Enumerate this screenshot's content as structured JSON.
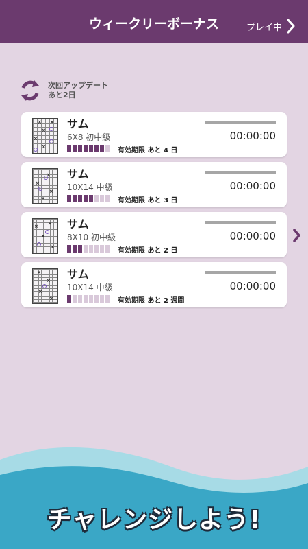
{
  "header": {
    "title": "ウィークリーボーナス",
    "playing_label": "プレイ中"
  },
  "update": {
    "line1": "次回アップデート",
    "line2": "あと2日"
  },
  "cards": [
    {
      "title": "サム",
      "size": "6X8 初中級",
      "filled": 7,
      "total": 8,
      "expiry": "有効期限 あと 4 日",
      "time": "00:00:00"
    },
    {
      "title": "サム",
      "size": "10X14 中級",
      "filled": 5,
      "total": 8,
      "expiry": "有効期限 あと 3 日",
      "time": "00:00:00"
    },
    {
      "title": "サム",
      "size": "8X10 初中級",
      "filled": 3,
      "total": 8,
      "expiry": "有効期限 あと 2 日",
      "time": "00:00:00"
    },
    {
      "title": "サム",
      "size": "10X14 中級",
      "filled": 1,
      "total": 8,
      "expiry": "有効期限 あと 2 週間",
      "time": "00:00:00"
    }
  ],
  "banner": {
    "text": "チャレンジしよう!"
  },
  "colors": {
    "accent": "#6b3a6e",
    "background": "#e3d5e3",
    "wave": "#3aa7c6"
  },
  "icons": {
    "refresh": "refresh-icon",
    "chevron": "chevron-right-icon"
  }
}
